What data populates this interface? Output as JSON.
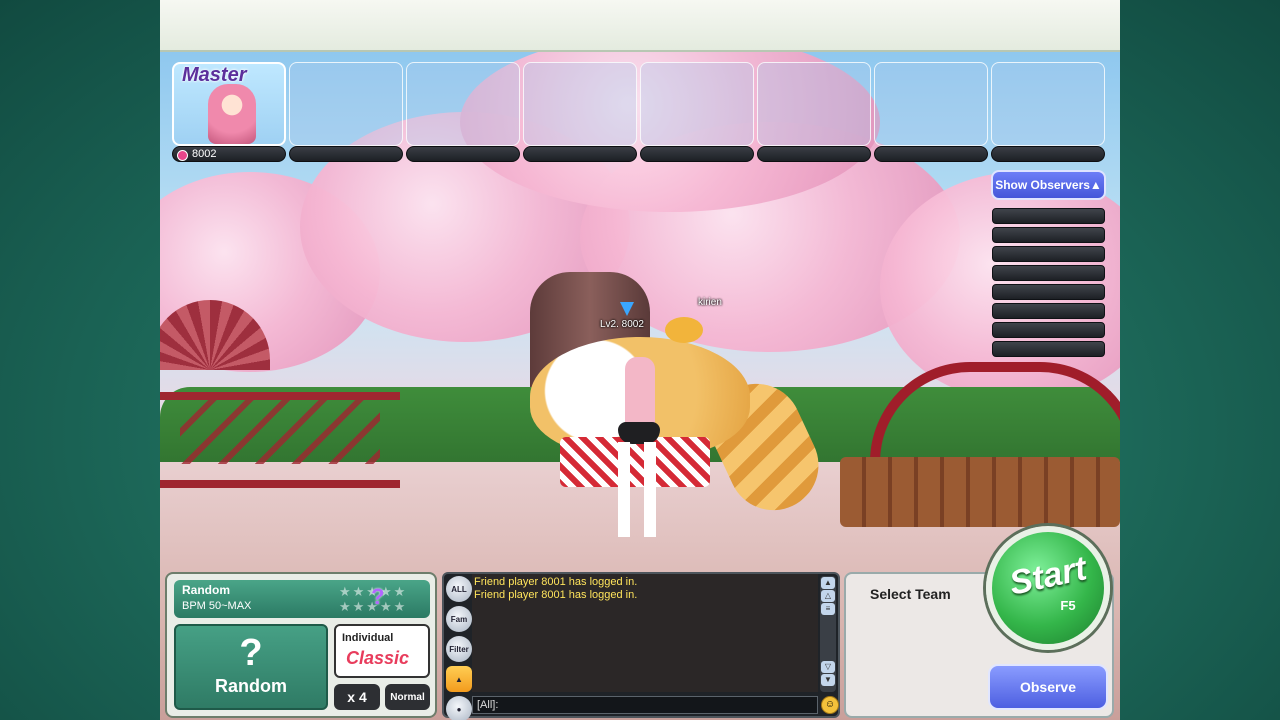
{
  "slots": [
    {
      "label": "Master",
      "score": "8002"
    },
    {
      "label": "",
      "score": ""
    },
    {
      "label": "",
      "score": ""
    },
    {
      "label": "",
      "score": ""
    },
    {
      "label": "",
      "score": ""
    },
    {
      "label": "",
      "score": ""
    },
    {
      "label": "",
      "score": ""
    },
    {
      "label": "",
      "score": ""
    }
  ],
  "observers": {
    "button_label": "Show Observers▲"
  },
  "scene": {
    "player_label": "Lv2. 8002",
    "pet_label": "kirien"
  },
  "song": {
    "title": "Random",
    "bpm": "BPM 50~MAX",
    "stars": "★★★★★",
    "difficulty_mark": "?",
    "random_icon": "?",
    "random_label": "Random",
    "mode_top": "Individual",
    "mode_main": "Classic",
    "count": "x 4",
    "difficulty": "Normal"
  },
  "chat": {
    "tabs": [
      "ALL",
      "Fam",
      "Filter",
      "",
      ""
    ],
    "messages": [
      "Friend player 8001 has logged in.",
      "Friend player 8001 has logged in."
    ],
    "input_value": "[All]:"
  },
  "team": {
    "select_label": "Select Team"
  },
  "start": {
    "label": "Start",
    "key": "F5"
  },
  "observe": {
    "label": "Observe"
  },
  "colors": {
    "accent_green": "#34b64a",
    "observe_blue": "#4d5fe1",
    "chat_text": "#ffe45c"
  }
}
